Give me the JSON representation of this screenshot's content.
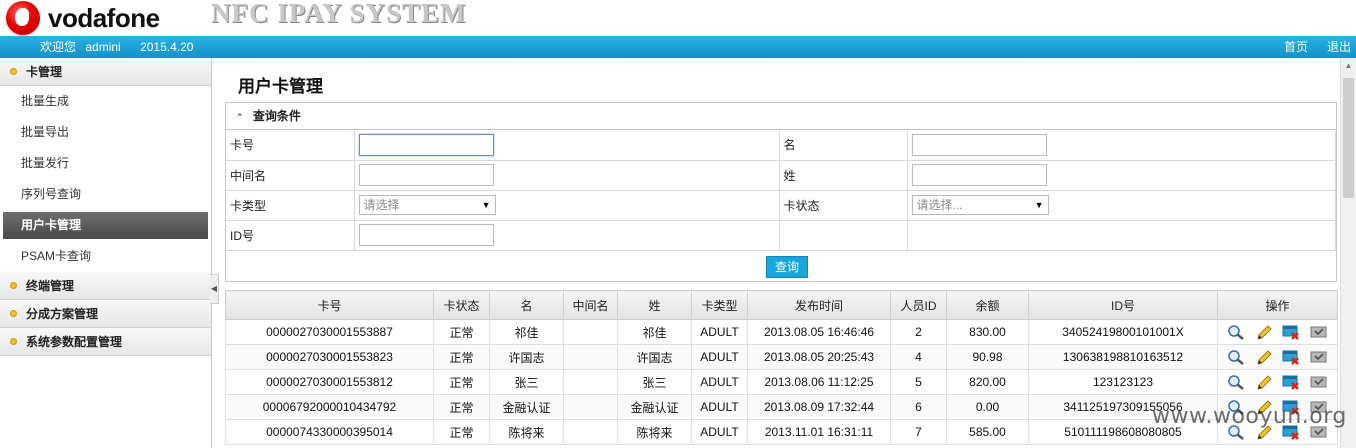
{
  "header": {
    "brand": "vodafone",
    "system_title": "NFC IPAY SYSTEM"
  },
  "topbar": {
    "welcome": "欢迎您",
    "user": "admini",
    "date": "2015.4.20",
    "home": "首页",
    "exit": "退出"
  },
  "sidebar": {
    "groups": [
      {
        "label": "卡管理",
        "items": [
          "批量生成",
          "批量导出",
          "批量发行",
          "序列号查询",
          "用户卡管理",
          "PSAM卡查询"
        ]
      },
      {
        "label": "终端管理"
      },
      {
        "label": "分成方案管理"
      },
      {
        "label": "系统参数配置管理"
      }
    ]
  },
  "page": {
    "title": "用户卡管理",
    "query_title": "查询条件",
    "fields": {
      "card_no": "卡号",
      "name": "名",
      "middle_name": "中间名",
      "surname": "姓",
      "card_type": "卡类型",
      "card_type_placeholder": "请选择",
      "card_status": "卡状态",
      "card_status_placeholder": "请选择...",
      "id_no": "ID号"
    },
    "search_button": "查询"
  },
  "table": {
    "columns": [
      "卡号",
      "卡状态",
      "名",
      "中间名",
      "姓",
      "卡类型",
      "发布时间",
      "人员ID",
      "余额",
      "ID号",
      "操作"
    ],
    "rows": [
      [
        "0000027030001553887",
        "正常",
        "祁佳",
        "",
        "祁佳",
        "ADULT",
        "2013.08.05 16:46:46",
        "2",
        "830.00",
        "34052419800101001X"
      ],
      [
        "0000027030001553823",
        "正常",
        "许国志",
        "",
        "许国志",
        "ADULT",
        "2013.08.05 20:25:43",
        "4",
        "90.98",
        "13063819881016351​2"
      ],
      [
        "0000027030001553812",
        "正常",
        "张三",
        "",
        "张三",
        "ADULT",
        "2013.08.06 11:12:25",
        "5",
        "820.00",
        "123123123"
      ],
      [
        "0000679200001043479​2",
        "正常",
        "金融认证",
        "",
        "金融认证",
        "ADULT",
        "2013.08.09 17:32:44",
        "6",
        "0.00",
        "341125197309155056"
      ],
      [
        "0000074330000395014",
        "正常",
        "陈将来",
        "",
        "陈将来",
        "ADULT",
        "2013.11.01 16:31:11",
        "7",
        "585.00",
        "510111198608080805"
      ]
    ],
    "ops_icons": [
      "view-icon",
      "edit-icon",
      "delete-icon",
      "more-icon"
    ]
  },
  "watermark": "www.wooyun.org",
  "colors": {
    "topbar": "#1a9ed3",
    "brand_red": "#e60000",
    "button": "#1aa6dd"
  }
}
